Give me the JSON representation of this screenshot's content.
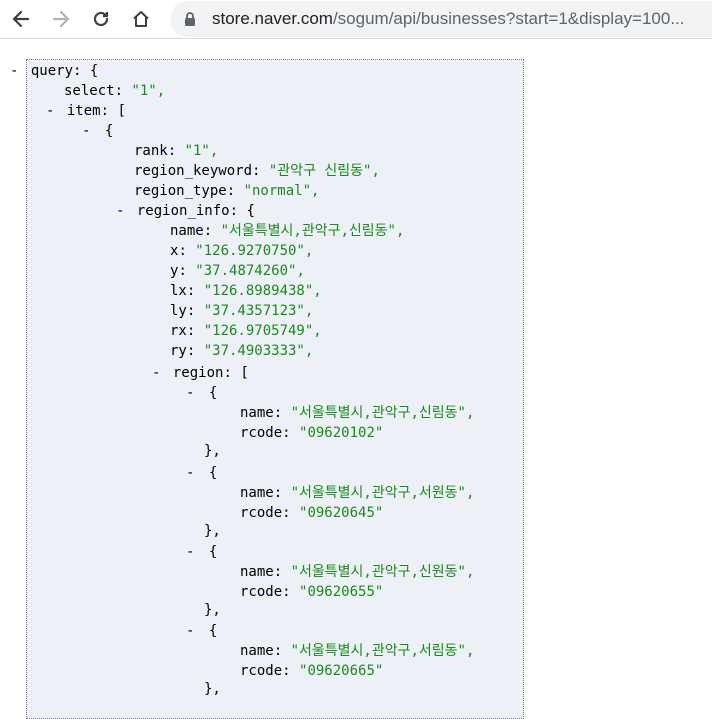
{
  "browser": {
    "url_host": "store.naver.com",
    "url_rest": "/sogum/api/businesses?start=1&display=100..."
  },
  "json": {
    "toggle": "-",
    "open_brace": "{",
    "open_bracket": "[",
    "close_brace_comma": "},",
    "keys": {
      "query": "query",
      "select": "select",
      "item": "item",
      "rank": "rank",
      "region_keyword": "region_keyword",
      "region_type": "region_type",
      "region_info": "region_info",
      "name": "name",
      "x": "x",
      "y": "y",
      "lx": "lx",
      "ly": "ly",
      "rx": "rx",
      "ry": "ry",
      "region": "region",
      "rcode": "rcode"
    },
    "values": {
      "select": "\"1\",",
      "rank": "\"1\",",
      "region_keyword": "\"관악구 신림동\",",
      "region_type": "\"normal\",",
      "name": "\"서울특별시,관악구,신림동\",",
      "x": "\"126.9270750\",",
      "y": "\"37.4874260\",",
      "lx": "\"126.8989438\",",
      "ly": "\"37.4357123\",",
      "rx": "\"126.9705749\",",
      "ry": "\"37.4903333\","
    },
    "regions": [
      {
        "name": "\"서울특별시,관악구,신림동\",",
        "rcode": "\"09620102\""
      },
      {
        "name": "\"서울특별시,관악구,서원동\",",
        "rcode": "\"09620645\""
      },
      {
        "name": "\"서울특별시,관악구,신원동\",",
        "rcode": "\"09620655\""
      },
      {
        "name": "\"서울특별시,관악구,서림동\",",
        "rcode": "\"09620665\""
      }
    ]
  }
}
